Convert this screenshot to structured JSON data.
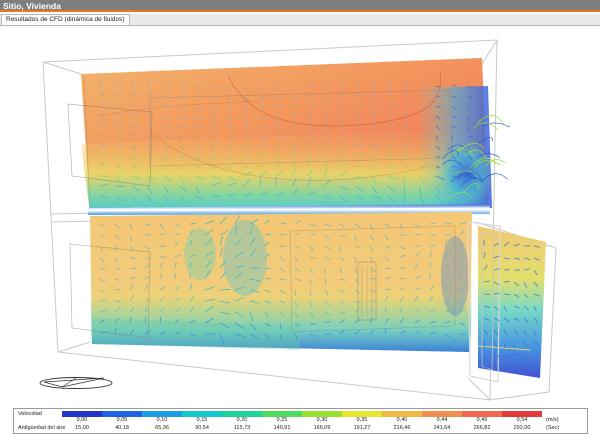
{
  "window": {
    "title": "Sitio, Vivienda"
  },
  "tabs": [
    {
      "label": "Resultados de CFD (dinámica de fluidos)"
    }
  ],
  "colors": {
    "titlebar": "#7e7e7e",
    "accent": "#e87722",
    "scale": [
      "#2236c9",
      "#1f64e0",
      "#1b9de8",
      "#17c7cf",
      "#21d19a",
      "#4ddc5e",
      "#9ce034",
      "#e6e532",
      "#f2b844",
      "#ee8f4e",
      "#ec6a4e",
      "#e33a3a"
    ]
  },
  "legend": {
    "rows": [
      {
        "label": "Velocidad",
        "values": [
          "0,00",
          "0,05",
          "0,10",
          "0,15",
          "0,20",
          "0,25",
          "0,30",
          "0,35",
          "0,40",
          "0,44",
          "0,49",
          "0,54"
        ],
        "unit": "(m/s)"
      },
      {
        "label": "Antigüedad del aire",
        "values": [
          "15,00",
          "40,18",
          "65,36",
          "90,54",
          "115,73",
          "140,91",
          "166,09",
          "191,27",
          "216,46",
          "241,64",
          "266,82",
          "292,00"
        ],
        "unit": "(Sec)"
      }
    ]
  }
}
